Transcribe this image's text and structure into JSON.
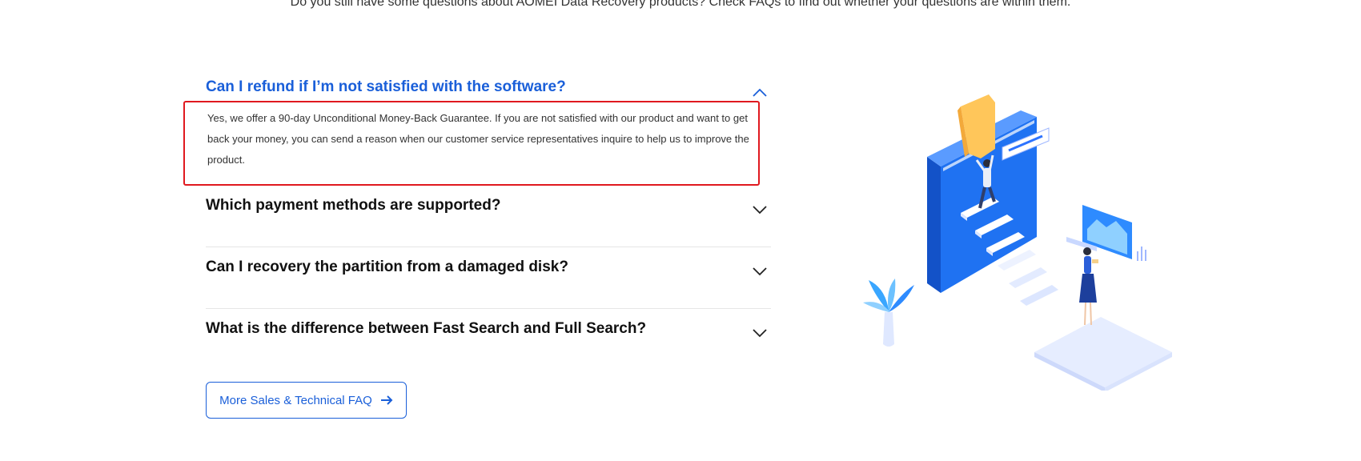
{
  "intro_text": "Do you still have some questions about AOMEI Data Recovery products? Check FAQs to find out whether your questions are within them.",
  "faq": {
    "items": [
      {
        "question": "Can I refund if I’m not satisfied with the software?",
        "answer": "Yes, we offer a 90-day Unconditional Money-Back Guarantee. If you are not satisfied with our product and want to get back your money, you can send a reason when our customer service representatives inquire to help us to improve the product.",
        "expanded": true
      },
      {
        "question": "Which payment methods are supported?",
        "expanded": false
      },
      {
        "question": "Can I recovery the partition from a damaged disk?",
        "expanded": false
      },
      {
        "question": "What is the difference between Fast Search and Full Search?",
        "expanded": false
      }
    ]
  },
  "more_button": {
    "label": "More Sales & Technical FAQ",
    "icon": "arrow-right-icon"
  },
  "colors": {
    "accent": "#1a5fd9",
    "highlight_border": "#e0191f"
  }
}
